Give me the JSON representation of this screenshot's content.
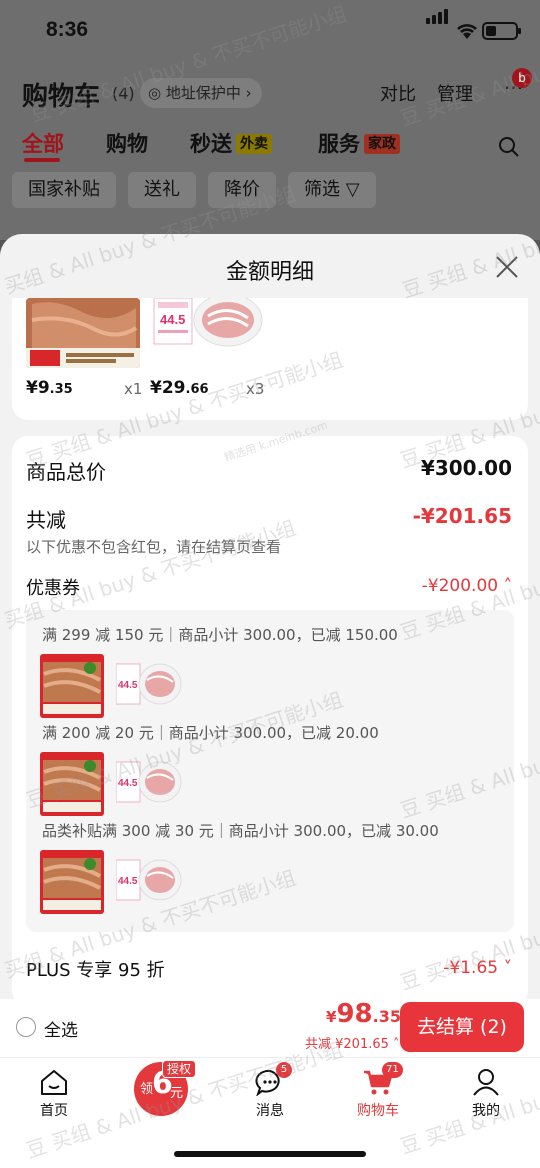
{
  "status_bar": {
    "time": "8:36"
  },
  "header": {
    "title": "购物车",
    "count": "(4)",
    "address": "地址保护中",
    "compare": "对比",
    "manage": "管理",
    "more": "···",
    "notification_dot": "b"
  },
  "tabs": [
    {
      "label": "全部",
      "active": true
    },
    {
      "label": "购物"
    },
    {
      "label": "秒送",
      "tag": "外卖"
    },
    {
      "label": "服务",
      "tag": "家政"
    }
  ],
  "filters": [
    "国家补贴",
    "送礼",
    "降价",
    "筛选"
  ],
  "sheet": {
    "title": "金额明细",
    "products": [
      {
        "price_int": "¥9",
        "price_dec": ".35",
        "qty": "x1"
      },
      {
        "price_int": "¥29",
        "price_dec": ".66",
        "qty": "x3"
      }
    ],
    "product_img_text": {
      "main": "海米烤 嫩嫩毛肚 200g/盒",
      "badge": "精选毛肚\n口感爽脆",
      "sticker": "44.5"
    },
    "total_label": "商品总价",
    "total_value": "¥300.00",
    "reduce_label": "共减",
    "reduce_value": "-¥201.65",
    "reduce_note": "以下优惠不包含红包，请在结算页查看",
    "coupon_label": "优惠券",
    "coupon_value": "-¥200.00",
    "coupon_lines": [
      "满 299 减 150 元｜商品小计 300.00，已减 150.00",
      "满 200 减 20 元｜商品小计 300.00，已减 20.00",
      "品类补贴满 300 减 30 元｜商品小计 300.00，已减 30.00"
    ],
    "plus_label": "PLUS 专享 95 折",
    "plus_value": "-¥1.65"
  },
  "bottom": {
    "select_all": "全选",
    "total_symbol": "¥",
    "total_int": "98",
    "total_dec": ".35",
    "total_reduce": "共减 ¥201.65",
    "checkout": "去结算 (2)"
  },
  "nav": {
    "home": "首页",
    "coin_prefix": "领",
    "coin_value": "6",
    "coin_suffix": "元",
    "coin_tag": "授权",
    "messages": "消息",
    "messages_badge": "5",
    "cart": "购物车",
    "cart_badge": "71",
    "mine": "我的"
  },
  "watermarks": [
    "买组 & All buy & 不买不可能小组",
    "豆 买组 & All buy & 不买不可能小组",
    "精选用 k.meinb.com"
  ],
  "colors": {
    "accent": "#e4393c",
    "dark_red": "#a0151b"
  }
}
